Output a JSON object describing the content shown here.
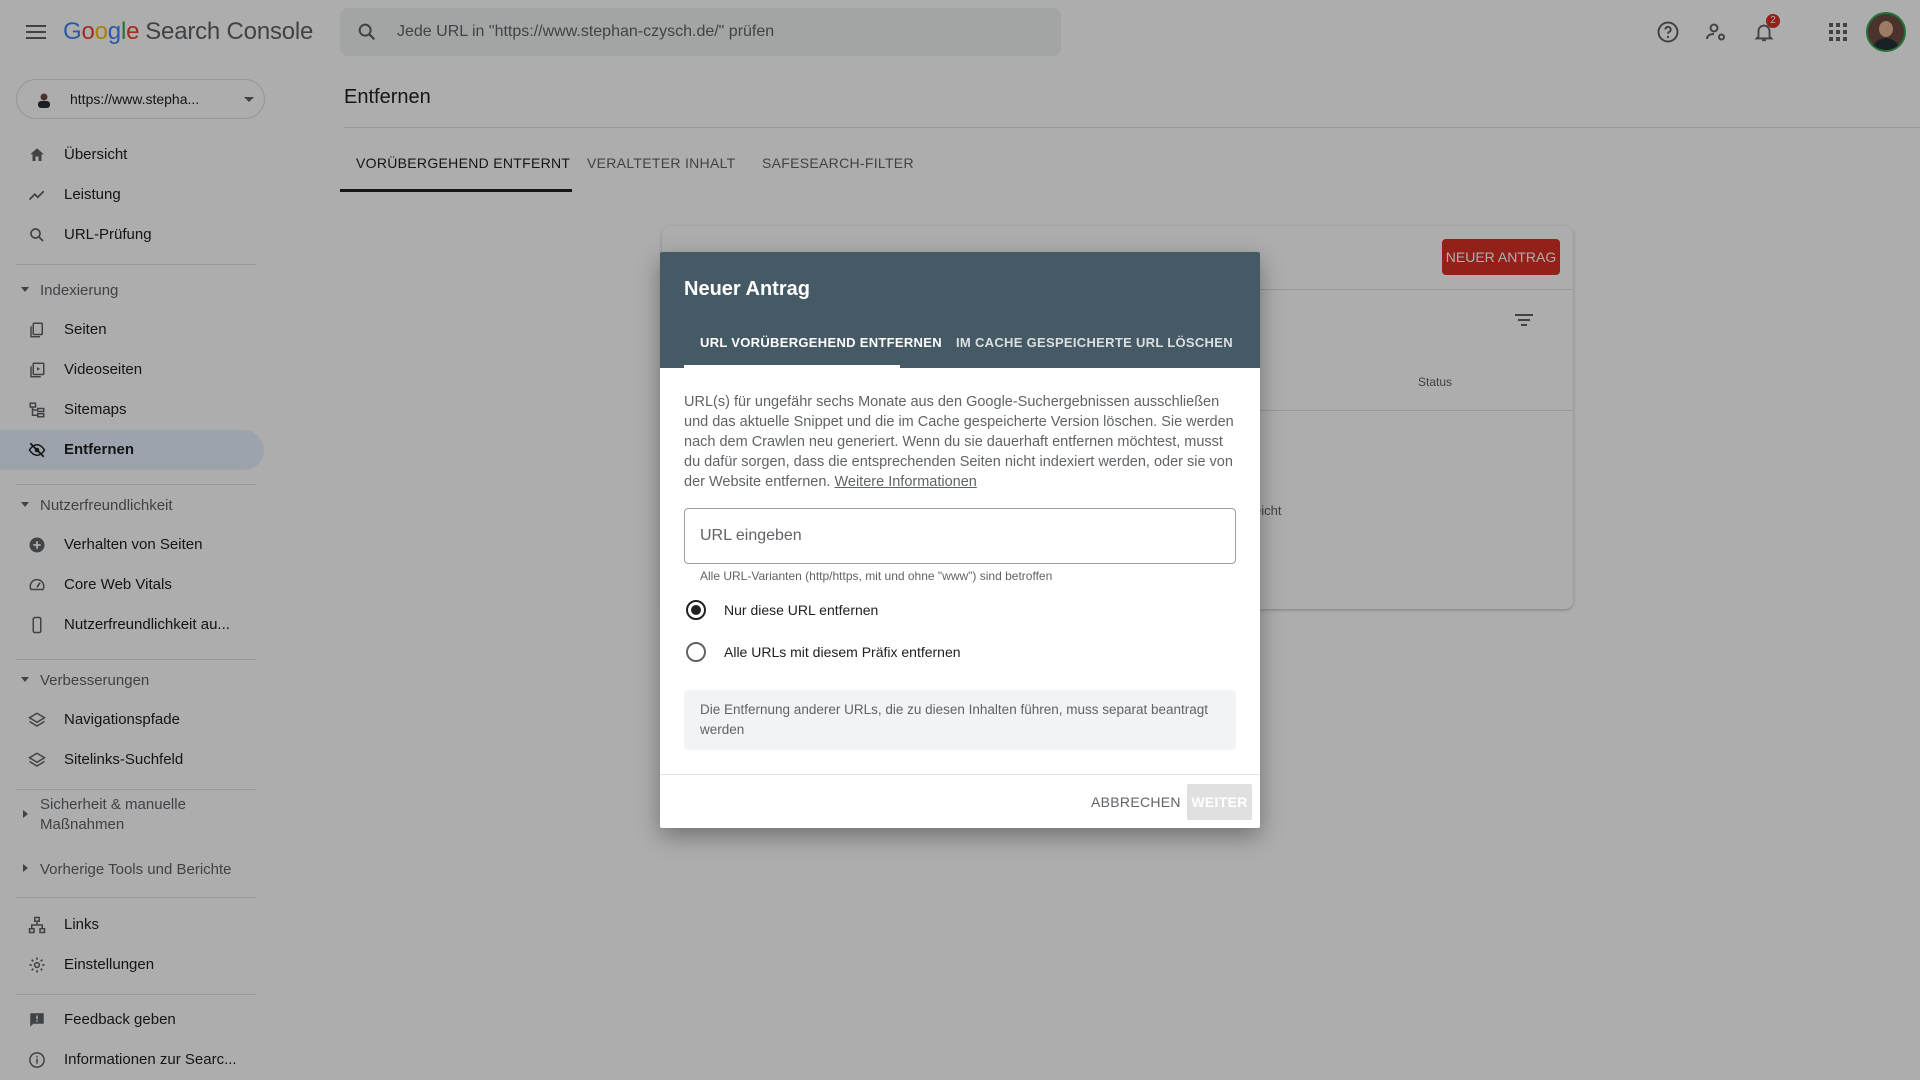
{
  "app": {
    "logo_letters": [
      "G",
      "o",
      "o",
      "g",
      "l",
      "e"
    ],
    "product": "Search Console",
    "search_placeholder": "Jede URL in \"https://www.stephan-czysch.de/\" prüfen",
    "notification_count": "2"
  },
  "property": {
    "label": "https://www.stepha..."
  },
  "sidebar": {
    "top_items": [
      {
        "label": "Übersicht",
        "icon": "home-icon"
      },
      {
        "label": "Leistung",
        "icon": "trending-icon"
      },
      {
        "label": "URL-Prüfung",
        "icon": "search-icon"
      }
    ],
    "sections": [
      {
        "label": "Indexierung",
        "items": [
          {
            "label": "Seiten",
            "icon": "pages-icon"
          },
          {
            "label": "Videoseiten",
            "icon": "video-pages-icon"
          },
          {
            "label": "Sitemaps",
            "icon": "sitemap-icon"
          },
          {
            "label": "Entfernen",
            "icon": "visibility-off-icon",
            "active": true
          }
        ]
      },
      {
        "label": "Nutzerfreundlichkeit",
        "items": [
          {
            "label": "Verhalten von Seiten",
            "icon": "plus-circle-icon"
          },
          {
            "label": "Core Web Vitals",
            "icon": "speed-icon"
          },
          {
            "label": "Nutzerfreundlichkeit au...",
            "icon": "phone-icon"
          }
        ]
      },
      {
        "label": "Verbesserungen",
        "items": [
          {
            "label": "Navigationspfade",
            "icon": "layers-icon"
          },
          {
            "label": "Sitelinks-Suchfeld",
            "icon": "layers-icon"
          }
        ]
      }
    ],
    "collapsed_sections": [
      "Sicherheit & manuelle Maßnahmen",
      "Vorherige Tools und Berichte"
    ],
    "bottom_items": [
      {
        "label": "Links",
        "icon": "links-icon"
      },
      {
        "label": "Einstellungen",
        "icon": "gear-icon"
      }
    ],
    "footer_items": [
      {
        "label": "Feedback geben",
        "icon": "feedback-icon"
      },
      {
        "label": "Informationen zur Searc...",
        "icon": "info-icon"
      }
    ]
  },
  "main": {
    "title": "Entfernen",
    "tabs": [
      "VORÜBERGEHEND ENTFERNT",
      "VERALTETER INHALT",
      "SAFESEARCH-FILTER"
    ],
    "card": {
      "new_request_button": "NEUER ANTRAG",
      "status_header": "Status",
      "partial_text": "eicht"
    }
  },
  "dialog": {
    "title": "Neuer Antrag",
    "tabs": [
      "URL VORÜBERGEHEND ENTFERNEN",
      "IM CACHE GESPEICHERTE URL LÖSCHEN"
    ],
    "description": "URL(s) für ungefähr sechs Monate aus den Google-Suchergebnissen ausschließen und das aktuelle Snippet und die im Cache gespeicherte Version löschen. Sie werden nach dem Crawlen neu generiert. Wenn du sie dauerhaft entfernen möchtest, musst du dafür sorgen, dass die entsprechenden Seiten nicht indexiert werden, oder sie von der Website entfernen.",
    "more_info_link": "Weitere Informationen",
    "url_input": {
      "placeholder": "URL eingeben",
      "value": ""
    },
    "url_helper": "Alle URL-Varianten (http/https, mit und ohne \"www\") sind betroffen",
    "radio_options": [
      {
        "label": "Nur diese URL entfernen",
        "checked": true
      },
      {
        "label": "Alle URLs mit diesem Präfix entfernen",
        "checked": false
      }
    ],
    "note": "Die Entfernung anderer URLs, die zu diesen Inhalten führen, muss separat beantragt werden",
    "cancel_label": "ABBRECHEN",
    "next_label": "WEITER"
  },
  "colors": {
    "dialog_header": "#455a64",
    "active_nav_bg": "#e8f0fe",
    "primary_red": "#d93025",
    "scrim": "rgba(0,0,0,0.32)"
  }
}
